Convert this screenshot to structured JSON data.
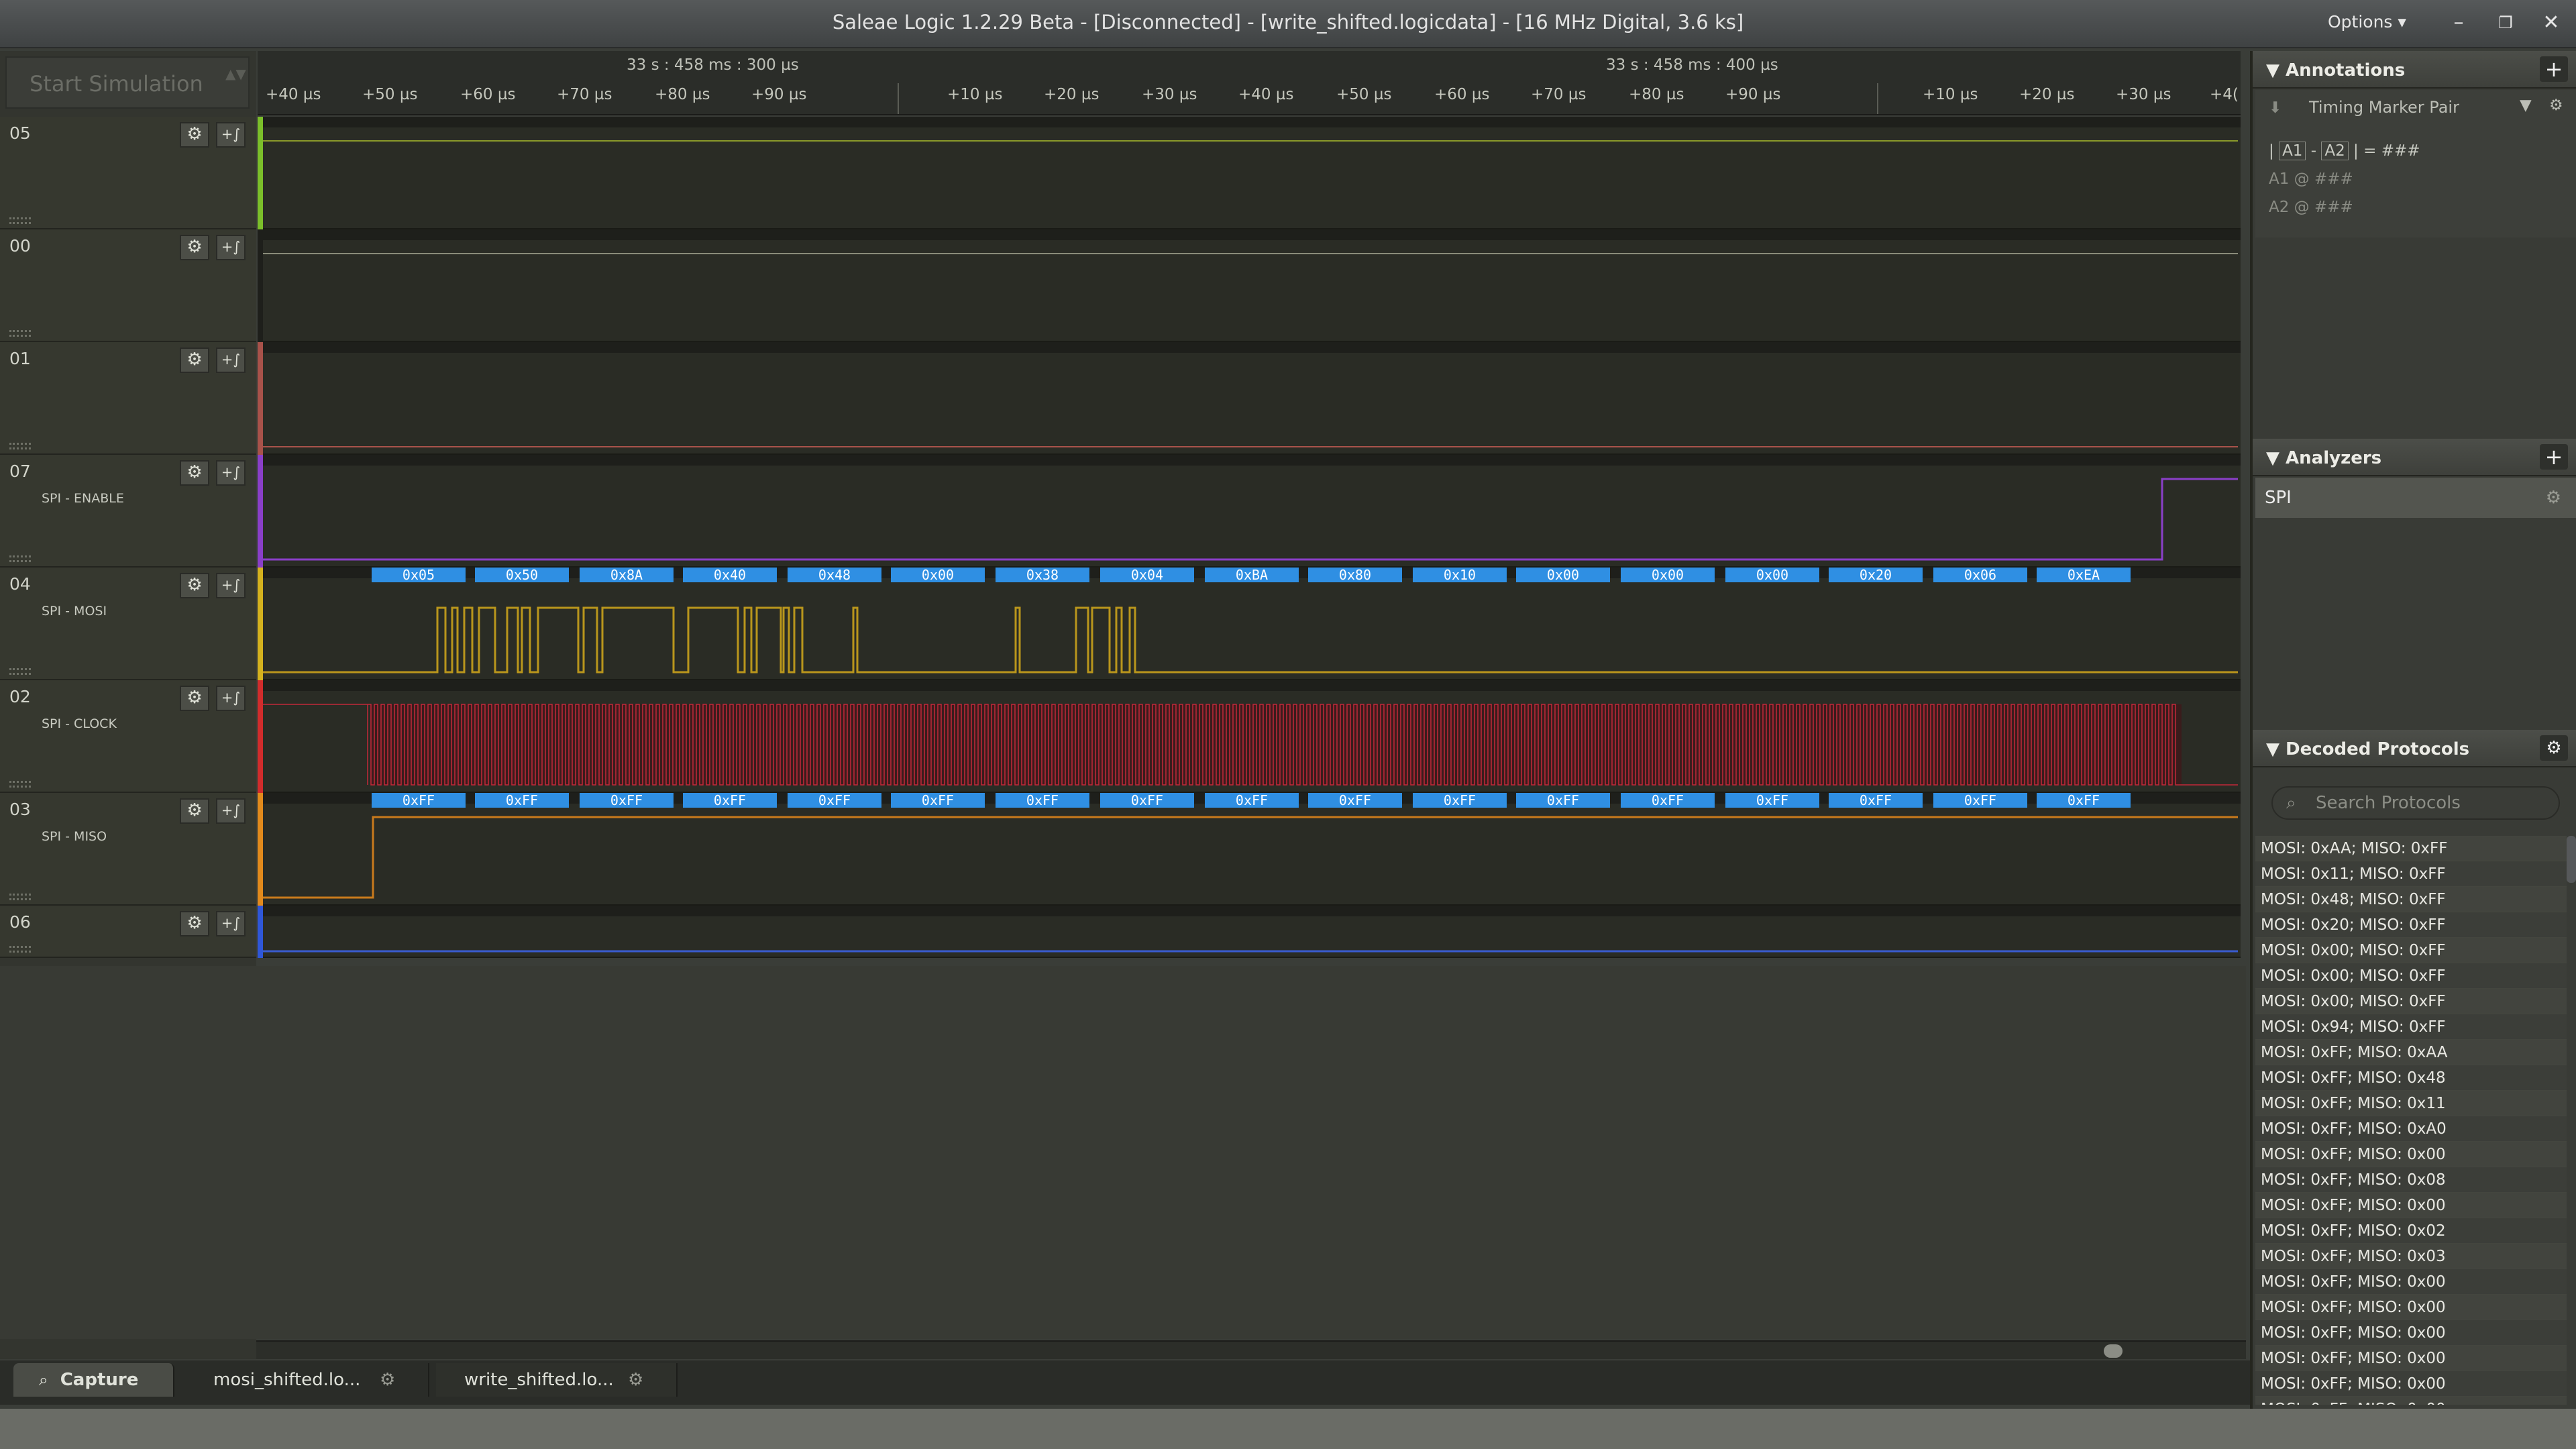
{
  "window": {
    "title": "Saleae Logic 1.2.29 Beta - [Disconnected] - [write_shifted.logicdata] - [16 MHz Digital, 3.6 ks]",
    "options_label": "Options ▾",
    "minimize_glyph": "–",
    "restore_glyph": "❐",
    "close_glyph": "✕"
  },
  "toolbar": {
    "start_simulation": "Start Simulation",
    "spinner_glyph": "▲▼"
  },
  "timeline": {
    "marker_labels": [
      "33 s : 458 ms : 300 µs",
      "33 s : 458 ms : 400 µs"
    ],
    "ticks": [
      "+40 µs",
      "+50 µs",
      "+60 µs",
      "+70 µs",
      "+80 µs",
      "+90 µs",
      "+10 µs",
      "+20 µs",
      "+30 µs",
      "+40 µs",
      "+50 µs",
      "+60 µs",
      "+70 µs",
      "+80 µs",
      "+90 µs",
      "+10 µs",
      "+20 µs",
      "+30 µs",
      "+4("
    ]
  },
  "channels": [
    {
      "num": "05",
      "name": "",
      "color": "#7bbf2a"
    },
    {
      "num": "00",
      "name": "",
      "color": "#1e1f1b"
    },
    {
      "num": "01",
      "name": "",
      "color": "#a8524a"
    },
    {
      "num": "07",
      "name": "SPI - ENABLE",
      "color": "#8a3fc8"
    },
    {
      "num": "04",
      "name": "SPI - MOSI",
      "color": "#d4b21e"
    },
    {
      "num": "02",
      "name": "SPI - CLOCK",
      "color": "#d12c2c"
    },
    {
      "num": "03",
      "name": "SPI - MISO",
      "color": "#e28a1c"
    },
    {
      "num": "06",
      "name": "",
      "color": "#2f57d8"
    }
  ],
  "channel_icons": {
    "gear": "⚙",
    "trigger": "+∫"
  },
  "decoded": {
    "mosi_bytes": [
      "0x05",
      "0x50",
      "0x8A",
      "0x40",
      "0x48",
      "0x00",
      "0x38",
      "0x04",
      "0xBA",
      "0x80",
      "0x10",
      "0x00",
      "0x00",
      "0x00",
      "0x20",
      "0x06",
      "0xEA"
    ],
    "miso_bytes": [
      "0xFF",
      "0xFF",
      "0xFF",
      "0xFF",
      "0xFF",
      "0xFF",
      "0xFF",
      "0xFF",
      "0xFF",
      "0xFF",
      "0xFF",
      "0xFF",
      "0xFF",
      "0xFF",
      "0xFF",
      "0xFF",
      "0xFF"
    ]
  },
  "tabs": [
    {
      "label": "Capture",
      "icon": "search-icon"
    },
    {
      "label": "mosi_shifted.lo...",
      "icon": "gear-icon"
    },
    {
      "label": "write_shifted.lo...",
      "icon": "gear-icon"
    }
  ],
  "annotations": {
    "title": "Annotations",
    "add_glyph": "+",
    "marker_pair": "Timing Marker Pair",
    "formula_a1": "A1",
    "formula_a2": "A2",
    "formula_rest": "= ###",
    "a1_row": "A1  @  ###",
    "a2_row": "A2  @  ###"
  },
  "analyzers": {
    "title": "Analyzers",
    "add_glyph": "+",
    "items": [
      "SPI"
    ]
  },
  "decoded_protocols": {
    "title": "Decoded Protocols",
    "search_placeholder": "Search Protocols",
    "items": [
      "MOSI: 0xAA;  MISO: 0xFF",
      "MOSI: 0x11;  MISO: 0xFF",
      "MOSI: 0x48;  MISO: 0xFF",
      "MOSI: 0x20;  MISO: 0xFF",
      "MOSI: 0x00;  MISO: 0xFF",
      "MOSI: 0x00;  MISO: 0xFF",
      "MOSI: 0x00;  MISO: 0xFF",
      "MOSI: 0x94;  MISO: 0xFF",
      "MOSI: 0xFF;  MISO: 0xAA",
      "MOSI: 0xFF;  MISO: 0x48",
      "MOSI: 0xFF;  MISO: 0x11",
      "MOSI: 0xFF;  MISO: 0xA0",
      "MOSI: 0xFF;  MISO: 0x00",
      "MOSI: 0xFF;  MISO: 0x08",
      "MOSI: 0xFF;  MISO: 0x00",
      "MOSI: 0xFF;  MISO: 0x02",
      "MOSI: 0xFF;  MISO: 0x03",
      "MOSI: 0xFF;  MISO: 0x00",
      "MOSI: 0xFF;  MISO: 0x00",
      "MOSI: 0xFF;  MISO: 0x00",
      "MOSI: 0xFF;  MISO: 0x00",
      "MOSI: 0xFF;  MISO: 0x00",
      "MOSI: 0xFF;  MISO: 0x00"
    ]
  }
}
